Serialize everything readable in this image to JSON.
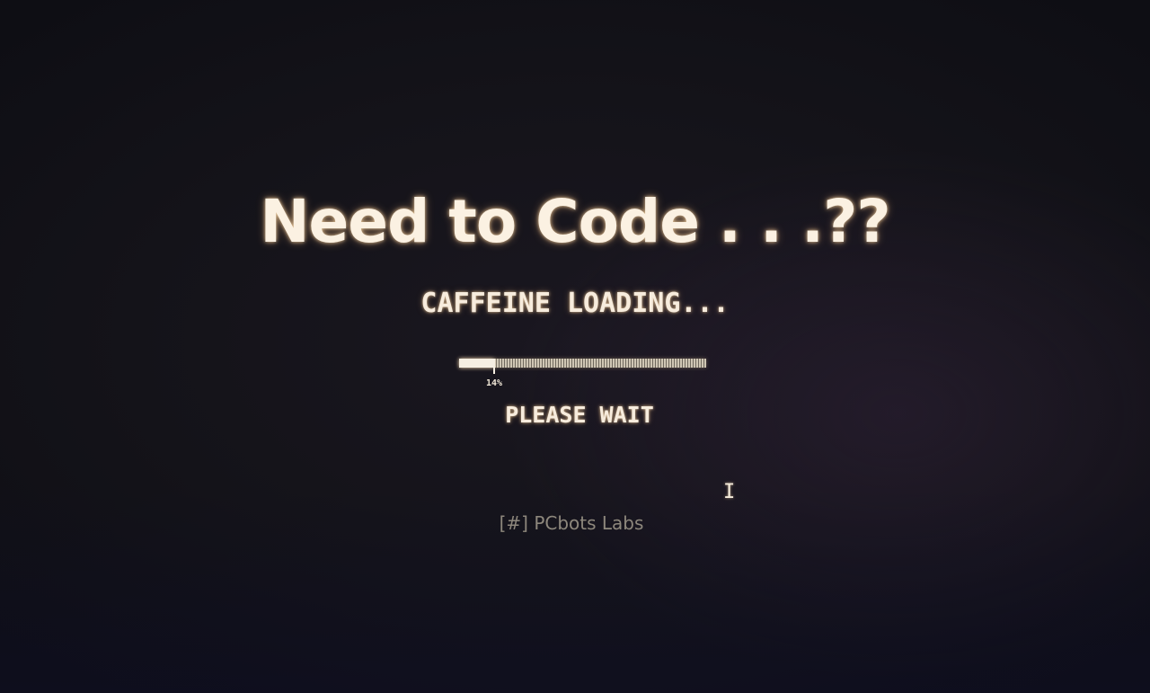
{
  "screen": {
    "headline": "Need to Code . . .??",
    "status_text": "CAFFEINE LOADING...",
    "progress": {
      "percent": 14,
      "label": "14%"
    },
    "wait_text": "PLEASE WAIT",
    "footer_brand": "[#] PCbots Labs"
  },
  "colors": {
    "background": "#141319",
    "text_glow": "#fbf1e2",
    "footer": "#8d877c"
  },
  "icons": {
    "cursor": "text-cursor-icon"
  }
}
